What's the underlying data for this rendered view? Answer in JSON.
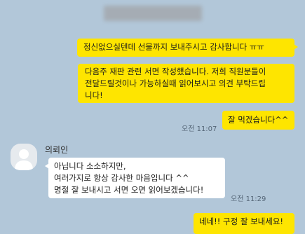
{
  "chat": {
    "messages": [
      {
        "side": "mine",
        "text": "정신없으실텐데 선물까지 보내주시고 감사합니다 ㅠㅠ"
      },
      {
        "side": "mine",
        "lines": [
          "다음주 재판 관련 서면 작성했습니다. 저희 직원분들이",
          "전달드릴것이나 가능하실때 읽어보시고 의견 부탁드립",
          "니다!"
        ]
      },
      {
        "side": "mine",
        "text": "잘 먹겠습니다^^",
        "time": "오전 11:07"
      },
      {
        "side": "theirs",
        "sender": "의뢰인",
        "lines": [
          "아닙니다 소소하지만,",
          "여러가지로 항상 감사한 마음입니다 ^^",
          "명절 잘 보내시고 서면 오면 읽어보겠습니다!"
        ],
        "time": "오전 11:29"
      },
      {
        "side": "mine",
        "text": "네네!! 구정 잘 보내세요!"
      }
    ]
  },
  "colors": {
    "background": "#b2c7d9",
    "my_bubble": "#fee500",
    "their_bubble": "#ffffff"
  },
  "icons": {
    "avatar": "default-profile-icon"
  }
}
